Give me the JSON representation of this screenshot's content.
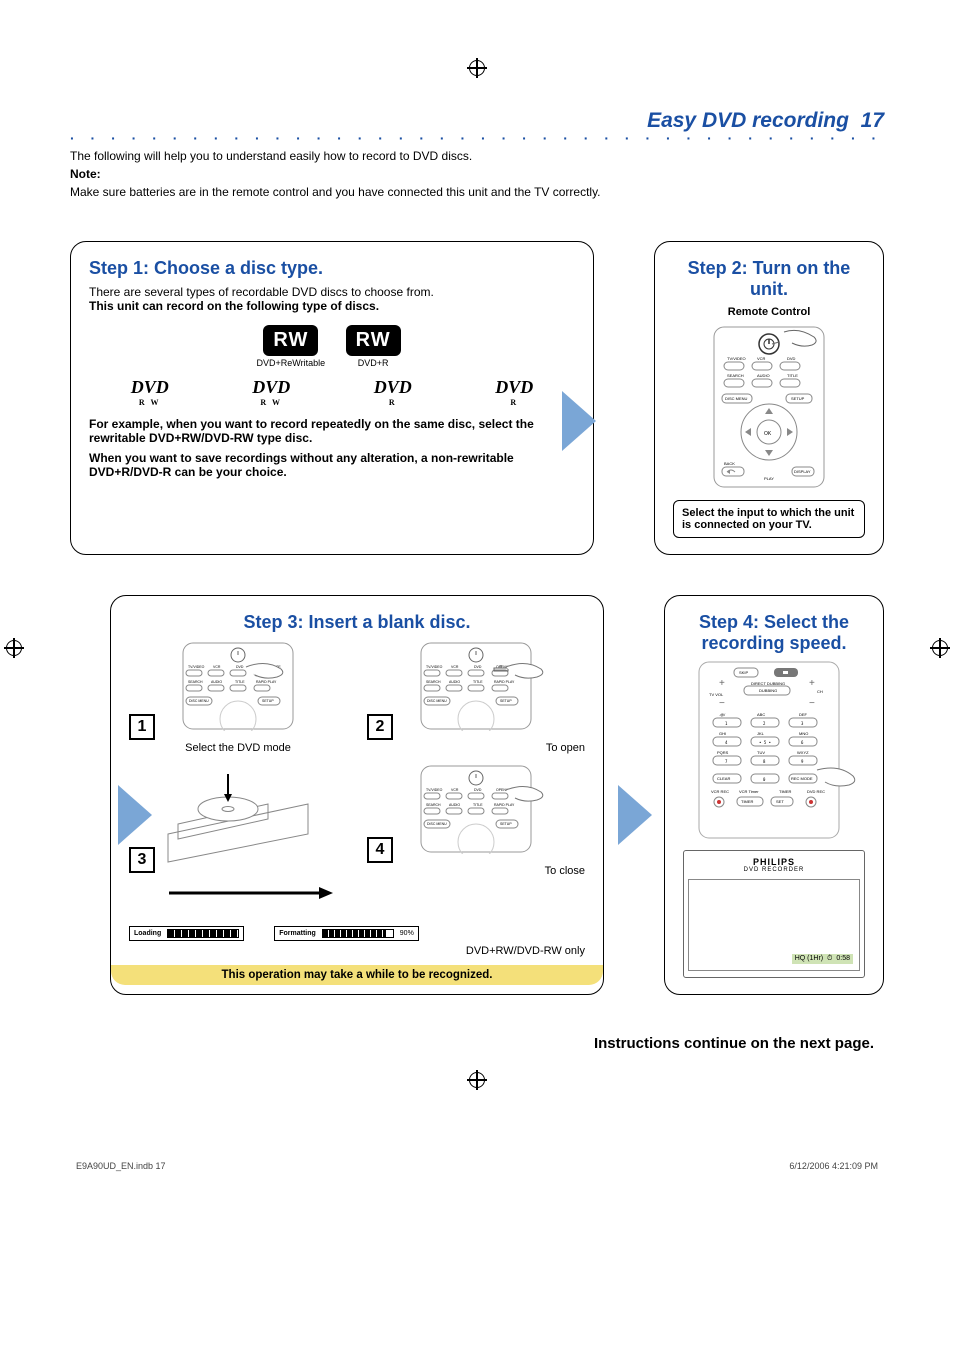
{
  "header": {
    "title": "Easy DVD recording",
    "page_number": "17"
  },
  "intro": {
    "line1": "The following will help you to understand easily how to record to DVD discs.",
    "note_label": "Note:",
    "line2": "Make sure batteries are in the remote control and you have connected this unit and the TV correctly."
  },
  "step1": {
    "title": "Step 1: Choose a disc type.",
    "text1": "There are several types of recordable DVD discs to choose from.",
    "text2_bold": "This unit can record on the following type of discs.",
    "logos": {
      "rw_rewritable_badge": "RW",
      "rw_rewritable_sub": "DVD+ReWritable",
      "rw_plusr_badge": "RW",
      "rw_plusr_sub": "DVD+R",
      "dvd_rw_1": "DVD",
      "dvd_rw_1_sub": "R W",
      "dvd_rw_2": "DVD",
      "dvd_rw_2_sub": "R W",
      "dvd_r_1": "DVD",
      "dvd_r_1_sub": "R",
      "dvd_r_2": "DVD",
      "dvd_r_2_sub": "R"
    },
    "para1": "For example, when you want to record repeatedly on the same disc, select the rewritable DVD+RW/DVD-RW type disc.",
    "para2": "When you want to save recordings without any alteration, a non-rewritable DVD+R/DVD-R can be your choice."
  },
  "step2": {
    "title": "Step 2: Turn on the unit.",
    "remote_label": "Remote Control",
    "remote_buttons": {
      "tv_video": "TV/VIDEO",
      "vcr": "VCR",
      "dvd": "DVD",
      "search": "SEARCH",
      "audio": "AUDIO",
      "title": "TITLE",
      "disc_menu": "DISC MENU",
      "setup": "SETUP",
      "ok": "OK",
      "back": "BACK",
      "play": "PLAY",
      "display": "DISPLAY"
    },
    "instruction": "Select the input to which the unit is connected on your TV."
  },
  "step3": {
    "title": "Step 3: Insert a blank disc.",
    "sub1_num": "1",
    "sub2_num": "2",
    "sub3_num": "3",
    "sub4_num": "4",
    "sub1_caption": "Select the DVD mode",
    "sub2_caption": "To open",
    "sub4_caption": "To close",
    "remote_buttons": {
      "tv_video": "TV/VIDEO",
      "vcr": "VCR",
      "dvd": "DVD",
      "open_close": "OPEN/CLOSE",
      "search": "SEARCH",
      "audio": "AUDIO",
      "title": "TITLE",
      "rapid": "RAPID PLAY",
      "disc_menu": "DISC MENU",
      "setup": "SETUP"
    },
    "loading_label": "Loading",
    "formatting_label": "Formatting",
    "formatting_percent": "90%",
    "rw_only": "DVD+RW/DVD-RW only",
    "yellow": "This operation may take a while to be recognized."
  },
  "step4": {
    "title": "Step 4: Select the recording speed.",
    "keypad": {
      "skip": "SKIP",
      "stop": "STOP",
      "tv_vol": "TV VOL",
      "direct_dubbing": "DIRECT DUBBING",
      "ch": "CH",
      "abc": "ABC",
      "def": "DEF",
      "ghi": "GHI",
      "jkl": "JKL",
      "mno": "MNO",
      "pqrs": "PQRS",
      "tuv": "TUV",
      "wxyz": "WXYZ",
      "n1": ".@/",
      "n5": "5",
      "clear": "CLEAR",
      "zero": "0",
      "rec_mode": "REC MODE",
      "vcr_rec": "VCR REC",
      "vcr_timer": "VCR Timer",
      "timer_btn": "TIMER",
      "timer_lbl": "TIMER",
      "set": "SET",
      "dvd_rec": "DVD REC"
    },
    "brand": "PHILIPS",
    "brand_sub": "DVD RECORDER",
    "hq": "HQ (1Hr)",
    "time": "0:58"
  },
  "continue_text": "Instructions continue on the next page.",
  "footer": {
    "left": "E9A90UD_EN.indb   17",
    "right": "6/12/2006   4:21:09 PM"
  }
}
